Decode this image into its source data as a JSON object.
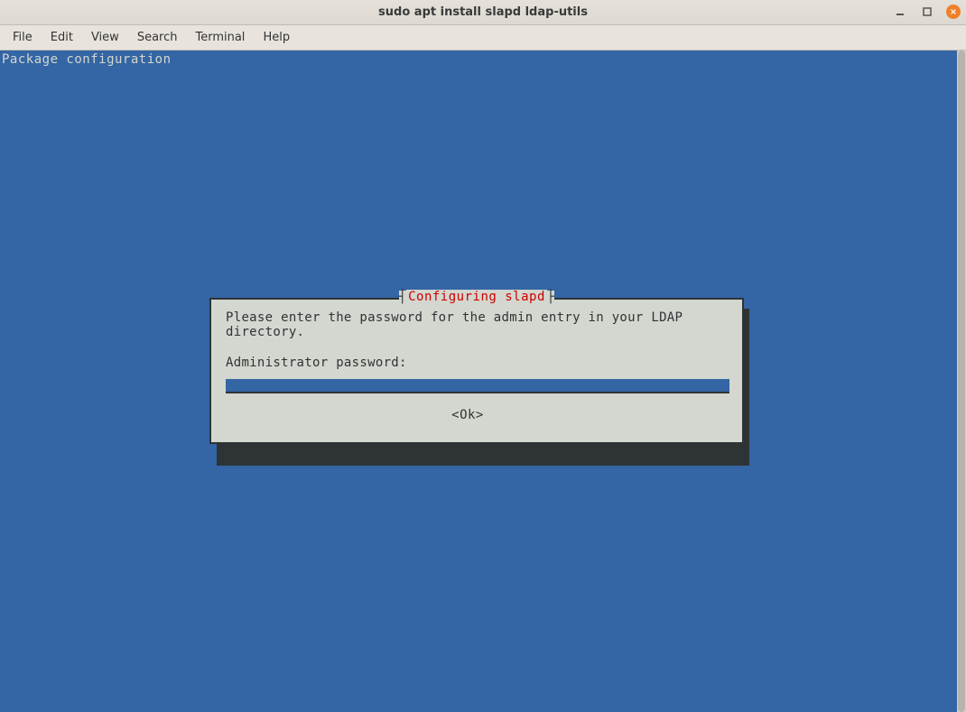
{
  "window": {
    "title": "sudo apt install slapd ldap-utils"
  },
  "menubar": {
    "items": [
      "File",
      "Edit",
      "View",
      "Search",
      "Terminal",
      "Help"
    ]
  },
  "terminal": {
    "header_text": "Package configuration"
  },
  "dialog": {
    "title": " Configuring slapd ",
    "message": "Please enter the password for the admin entry in your LDAP directory.",
    "prompt": "Administrator password:",
    "password_value": "",
    "ok_label": "<Ok>"
  }
}
